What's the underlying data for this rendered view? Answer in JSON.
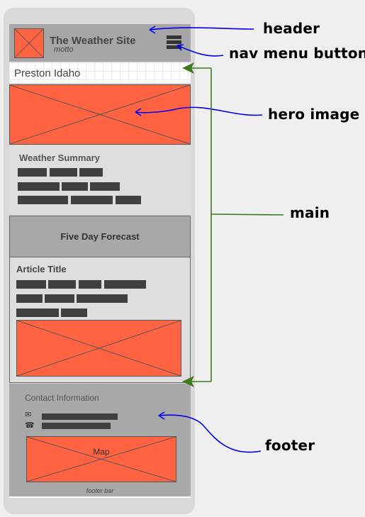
{
  "header": {
    "site_title": "The Weather Site",
    "motto": "motto"
  },
  "main": {
    "location": "Preston Idaho",
    "summary_title": "Weather Summary",
    "forecast_label": "Five Day Forecast",
    "article_title": "Article Title"
  },
  "footer": {
    "contact_title": "Contact Information",
    "email_icon": "✉",
    "phone_icon": "☎",
    "map_label": "Map",
    "footer_bar": "footer bar"
  },
  "annotations": {
    "header": "header",
    "nav_menu_button": "nav menu button",
    "hero_image": "hero image",
    "main": "main",
    "footer": "footer"
  },
  "colors": {
    "placeholder": "#ff6342",
    "arrow_blue": "#0000ee",
    "bracket_green": "#3d7a1e"
  }
}
